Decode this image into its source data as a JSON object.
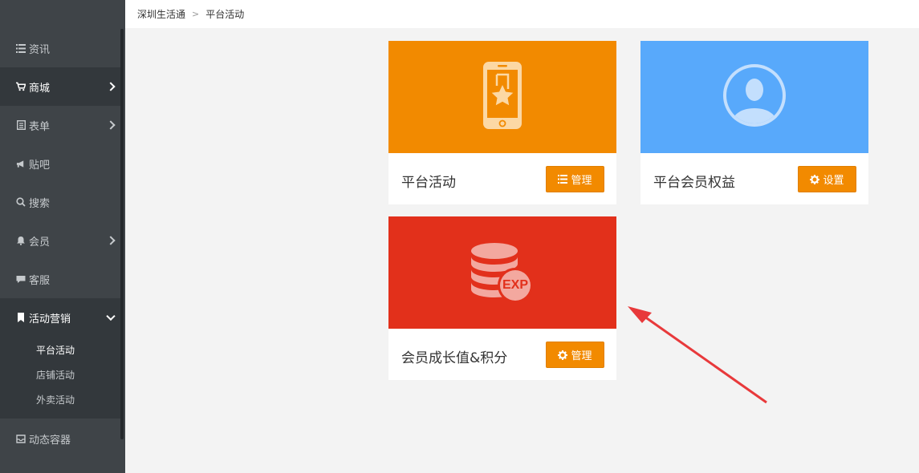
{
  "sidebar": {
    "items": [
      {
        "label": "资讯",
        "icon": "list-icon"
      },
      {
        "label": "商城",
        "icon": "cart-icon"
      },
      {
        "label": "表单",
        "icon": "form-icon"
      },
      {
        "label": "贴吧",
        "icon": "bullhorn-icon"
      },
      {
        "label": "搜索",
        "icon": "search-icon"
      },
      {
        "label": "会员",
        "icon": "bell-icon"
      },
      {
        "label": "客服",
        "icon": "chat-icon"
      },
      {
        "label": "活动营销",
        "icon": "bookmark-icon"
      },
      {
        "label": "动态容器",
        "icon": "inbox-icon"
      }
    ],
    "submenu": [
      "平台活动",
      "店铺活动",
      "外卖活动"
    ]
  },
  "breadcrumb": {
    "root": "深圳生活通",
    "current": "平台活动"
  },
  "cards": [
    {
      "title": "平台活动",
      "button": "管理",
      "button_icon": "list-icon",
      "color": "#f28a00"
    },
    {
      "title": "平台会员权益",
      "button": "设置",
      "button_icon": "gear-icon",
      "color": "#58a9fb"
    },
    {
      "title": "会员成长值&积分",
      "button": "管理",
      "button_icon": "gear-icon",
      "color": "#e2301b",
      "badge": "EXP"
    }
  ],
  "colors": {
    "sidebar": "#3f4448",
    "accent": "#f28a00",
    "arrow": "#e8393b"
  }
}
